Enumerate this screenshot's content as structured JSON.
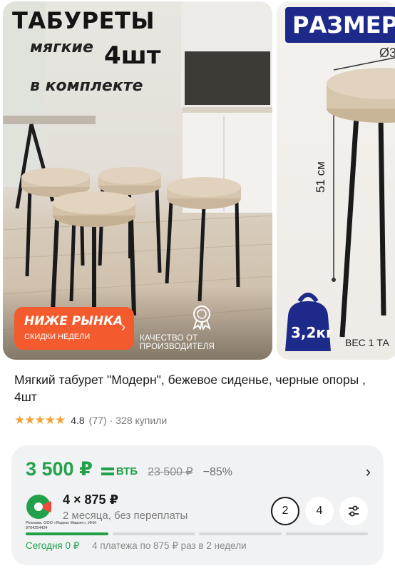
{
  "gallery": {
    "slide1": {
      "title": "ТАБУРЕТЫ",
      "subtitle_soft": "мягкие",
      "subtitle_count": "4шт",
      "subtitle_set": "в комплекте",
      "badge_title": "НИЖЕ РЫНКА",
      "badge_subtitle": "СКИДКИ НЕДЕЛИ",
      "quality_label": "КАЧЕСТВО ОТ ПРОИЗВОДИТЕЛЯ"
    },
    "slide2": {
      "title": "РАЗМЕР",
      "diameter_label": "Ø3",
      "height_label": "51 см",
      "weight_value": "3,2кг",
      "weight_text": "ВЕС 1 ТА"
    }
  },
  "product": {
    "title": "Мягкий табурет \"Модерн\", бежевое сиденье, черные опоры , 4шт",
    "stars": "★★★★★",
    "rating": "4.8",
    "reviews": "(77)",
    "separator": "·",
    "purchases": "328 купили"
  },
  "price_card": {
    "price": "3 500 ₽",
    "bank_label": "ВТБ",
    "old_price": "23 500 ₽",
    "discount": "−85%",
    "installment": "4 × 875 ₽",
    "installment_sub": "2 месяца, без переплаты",
    "ads_note": "Реклама. ООО «Яндекс Маркет», ИНН 9704254424",
    "term_options": [
      "2",
      "4"
    ],
    "today_label": "Сегодня 0 ₽",
    "schedule_text": "4 платежа по 875 ₽ раз в 2 недели",
    "payments_paid_fraction": 0.25
  },
  "colors": {
    "accent_green": "#22a14a",
    "promo_orange": "#f35a2d",
    "banner_blue": "#1e2a8a",
    "star_orange": "#f2a33a"
  }
}
